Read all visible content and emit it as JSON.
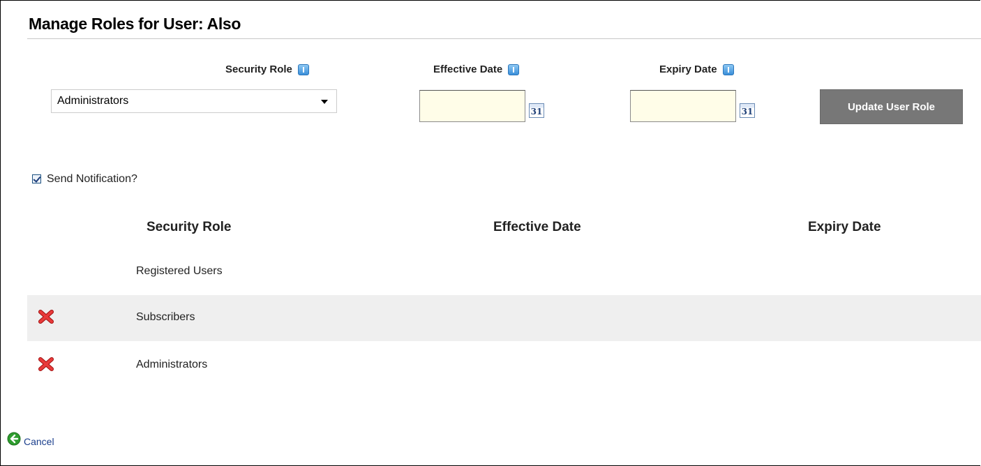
{
  "page": {
    "title": "Manage Roles for User: Also"
  },
  "form": {
    "security_role_label": "Security Role",
    "effective_date_label": "Effective Date",
    "expiry_date_label": "Expiry Date",
    "security_role_selected": "Administrators",
    "effective_date_value": "",
    "expiry_date_value": "",
    "calendar_icon_text": "31",
    "update_button_label": "Update User Role",
    "send_notification_label": "Send Notification?",
    "send_notification_checked": true
  },
  "table": {
    "headers": {
      "security_role": "Security Role",
      "effective_date": "Effective Date",
      "expiry_date": "Expiry Date"
    },
    "rows": [
      {
        "role": "Registered Users",
        "effective": "",
        "expiry": "",
        "deletable": false
      },
      {
        "role": "Subscribers",
        "effective": "",
        "expiry": "",
        "deletable": true
      },
      {
        "role": "Administrators",
        "effective": "",
        "expiry": "",
        "deletable": true
      }
    ]
  },
  "footer": {
    "cancel_label": "Cancel"
  },
  "icons": {
    "help": "help-icon",
    "calendar": "calendar-icon",
    "delete": "delete-x-icon",
    "cancel": "back-arrow-icon"
  },
  "colors": {
    "button_bg": "#777777",
    "date_input_bg": "#fffde8",
    "alt_row_bg": "#efefef",
    "link": "#1a3e8c",
    "delete_red": "#d42020",
    "cancel_green": "#2e9d2e"
  }
}
